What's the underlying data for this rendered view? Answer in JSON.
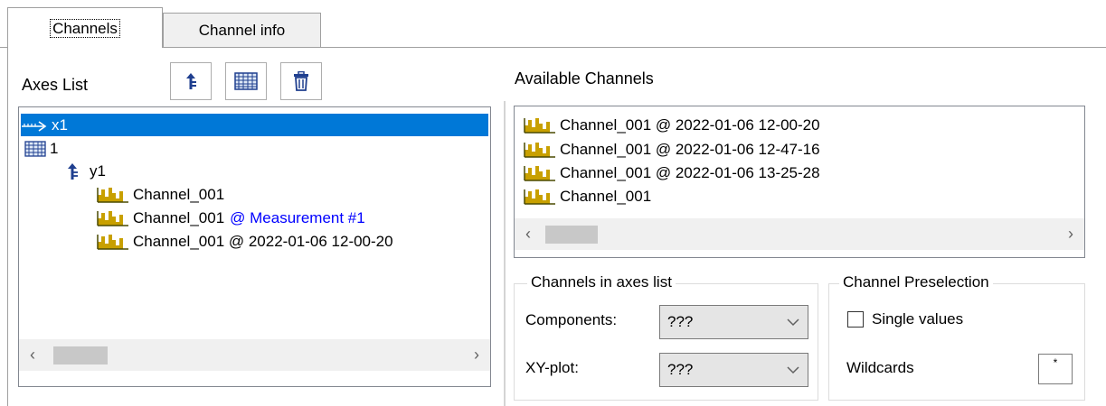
{
  "tabs": [
    {
      "label": "Channels",
      "active": true
    },
    {
      "label": "Channel info",
      "active": false
    }
  ],
  "axes_panel": {
    "title": "Axes List",
    "toolbar": [
      {
        "icon": "add-y-axis-icon"
      },
      {
        "icon": "add-system-icon"
      },
      {
        "icon": "delete-icon"
      }
    ],
    "tree": [
      {
        "icon": "x-axis-icon",
        "label": "x1",
        "suffix": "",
        "selected": true
      },
      {
        "icon": "system-icon",
        "label": "1",
        "suffix": "",
        "selected": false
      },
      {
        "icon": "y-axis-icon",
        "label": "y1",
        "suffix": "",
        "selected": false
      },
      {
        "icon": "channel-icon",
        "label": "Channel_001",
        "suffix": "",
        "selected": false
      },
      {
        "icon": "channel-icon",
        "label": "Channel_001",
        "suffix": "@ Measurement #1",
        "selected": false
      },
      {
        "icon": "channel-icon",
        "label": "Channel_001 @ 2022-01-06 12-00-20",
        "suffix": "",
        "selected": false
      }
    ]
  },
  "available_panel": {
    "title": "Available Channels",
    "items": [
      {
        "icon": "channel-icon",
        "label": "Channel_001 @ 2022-01-06 12-00-20"
      },
      {
        "icon": "channel-icon",
        "label": "Channel_001 @ 2022-01-06 12-47-16"
      },
      {
        "icon": "channel-icon",
        "label": "Channel_001 @ 2022-01-06 13-25-28"
      },
      {
        "icon": "channel-icon",
        "label": "Channel_001"
      }
    ]
  },
  "channels_in_axes": {
    "title": "Channels in axes list",
    "components_label": "Components:",
    "components_value": "???",
    "xy_label": "XY-plot:",
    "xy_value": "???"
  },
  "preselection": {
    "title": "Channel Preselection",
    "single_values_label": "Single values",
    "single_values_checked": false,
    "wildcards_label": "Wildcards",
    "wildcards_value": "*"
  },
  "colors": {
    "selection": "#0078d7",
    "measurement_link": "#0000ff",
    "icon_gold": "#b8860b",
    "icon_dark": "#5a5a00"
  }
}
